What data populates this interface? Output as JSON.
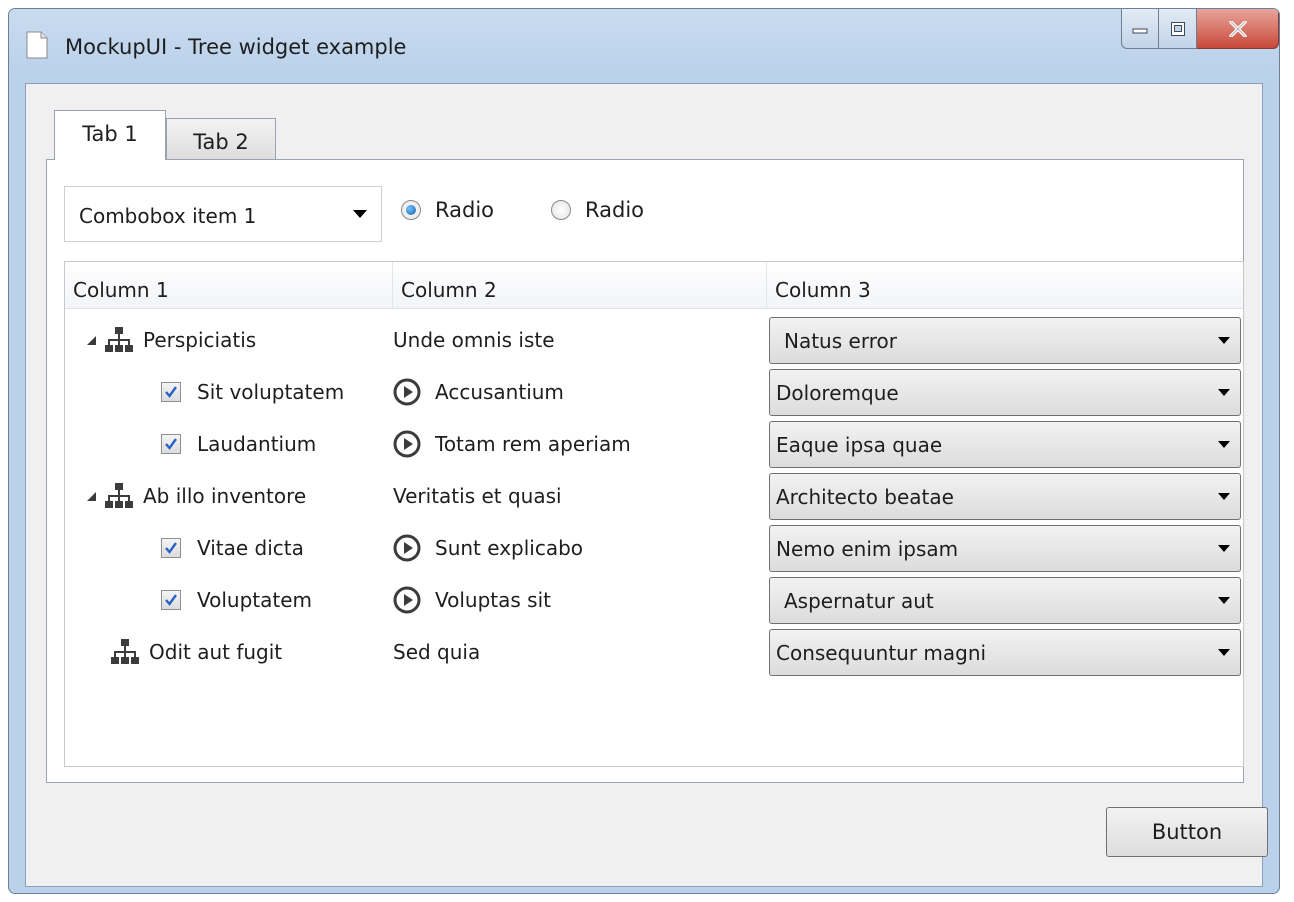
{
  "window": {
    "title": "MockupUI - Tree widget example"
  },
  "tabs": [
    {
      "label": "Tab 1",
      "selected": true
    },
    {
      "label": "Tab 2",
      "selected": false
    }
  ],
  "combobox": {
    "selected": "Combobox item 1"
  },
  "radios": [
    {
      "label": "Radio",
      "checked": true
    },
    {
      "label": "Radio",
      "checked": false
    }
  ],
  "tree": {
    "columns": [
      "Column 1",
      "Column 2",
      "Column 3"
    ],
    "rows": [
      {
        "col1": "Perspiciatis",
        "col2": "Unde omnis iste",
        "col3": "Natus error"
      },
      {
        "col1": "Sit voluptatem",
        "col2": "Accusantium",
        "col3": "Doloremque"
      },
      {
        "col1": "Laudantium",
        "col2": "Totam rem aperiam",
        "col3": "Eaque ipsa quae"
      },
      {
        "col1": "Ab illo inventore",
        "col2": "Veritatis et quasi",
        "col3": "Architecto beatae"
      },
      {
        "col1": "Vitae dicta",
        "col2": "Sunt explicabo",
        "col3": "Nemo enim ipsam"
      },
      {
        "col1": "Voluptatem",
        "col2": "Voluptas sit",
        "col3": "Aspernatur aut"
      },
      {
        "col1": "Odit aut fugit",
        "col2": "Sed quia",
        "col3": "Consequuntur magni"
      }
    ]
  },
  "button": {
    "label": "Button"
  },
  "icons": {
    "document": "document-icon",
    "minimize": "minimize-icon",
    "maximize": "maximize-icon",
    "close": "close-icon",
    "network": "network-icon",
    "play": "play-icon",
    "checkmark": "checkmark-icon",
    "dropdown": "chevron-down-icon"
  },
  "colors": {
    "titlebar": "#b9d1ea",
    "close_button": "#c7493a",
    "window_bg": "#f0f0f0",
    "radio_selected": "#1a5fa8"
  }
}
